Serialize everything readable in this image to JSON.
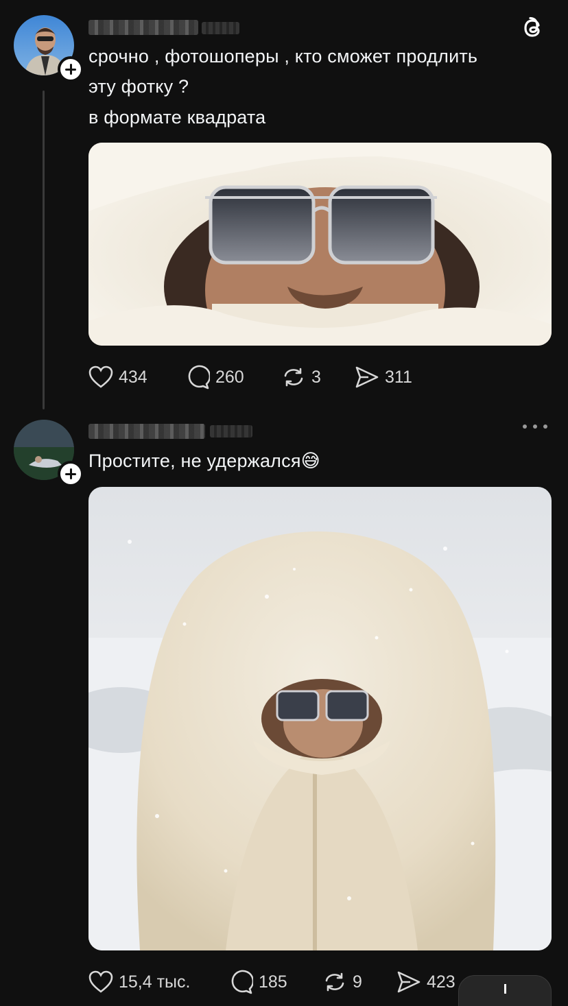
{
  "post1": {
    "text_line1": "срочно , фотошоперы , кто сможет продлить",
    "text_line2": "эту фотку ?",
    "text_line3": "в формате квадрата",
    "likes": "434",
    "comments": "260",
    "reposts": "3",
    "shares": "311"
  },
  "post2": {
    "text": "Простите, не удержался",
    "emoji": "😅",
    "likes": "15,4 тыс.",
    "comments": "185",
    "reposts": "9",
    "shares": "423"
  },
  "icons": {
    "app": "threads-icon",
    "like": "heart-icon",
    "comment": "comment-icon",
    "repost": "repost-icon",
    "share": "share-icon",
    "more": "more-icon"
  },
  "colors": {
    "background": "#101010",
    "text": "#f3f5f7",
    "muted": "#d8d8d8"
  }
}
